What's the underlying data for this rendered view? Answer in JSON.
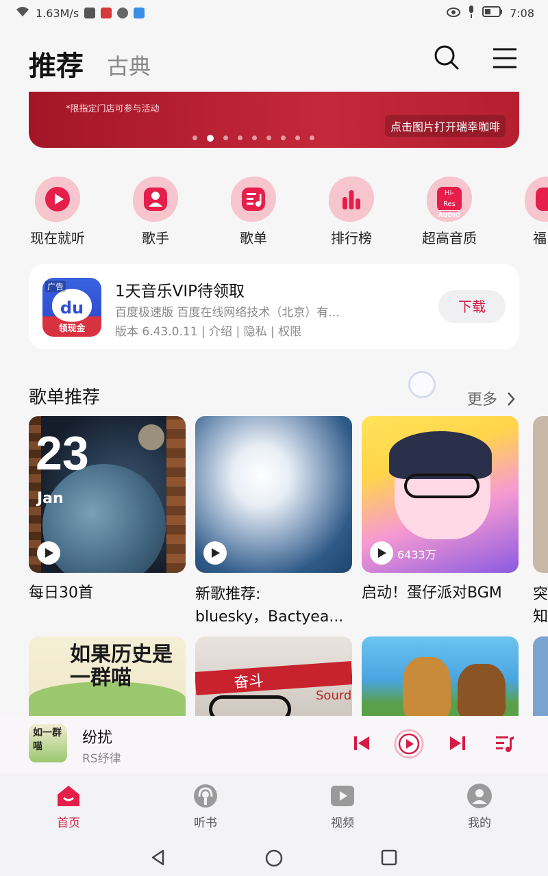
{
  "status_bar": {
    "speed": "1.63M/s",
    "time": "7:08"
  },
  "header": {
    "tab_active": "推荐",
    "tab_inactive": "古典",
    "search_icon": "search-icon",
    "menu_icon": "menu-icon"
  },
  "banner": {
    "note": "*限指定门店可参与活动",
    "cta": "点击图片打开瑞幸咖啡",
    "dot_count": 9,
    "active_dot": 2
  },
  "quick_nav": [
    {
      "label": "现在就听",
      "icon": "play-circle-icon"
    },
    {
      "label": "歌手",
      "icon": "singer-icon"
    },
    {
      "label": "歌单",
      "icon": "playlist-icon"
    },
    {
      "label": "排行榜",
      "icon": "chart-bars-icon"
    },
    {
      "label": "超高音质",
      "icon": "hi-res-icon",
      "badge_top": "Hi-Res",
      "badge_bottom": "AUDIO"
    },
    {
      "label": "福",
      "icon": "benefit-icon"
    }
  ],
  "ad": {
    "badge": "广告",
    "logo_text": "du",
    "logo_strip": "领现金",
    "title": "1天音乐VIP待领取",
    "subtitle": "百度极速版  百度在线网络技术（北京）有...",
    "meta": "版本 6.43.0.11 | 介绍 | 隐私 | 权限",
    "button": "下载"
  },
  "section": {
    "title": "歌单推荐",
    "more": "更多"
  },
  "playlists": [
    {
      "title": "每日30首",
      "date_day": "23",
      "date_month": "Jan"
    },
    {
      "title_line1": "新歌推荐:",
      "title_line2": "bluesky，Bactyea..."
    },
    {
      "title": "启动！蛋仔派对BGM",
      "play_count": "6433万"
    },
    {
      "title_line1": "突",
      "title_line2": "知"
    }
  ],
  "row2": {
    "card1_text": "如果历史是一群喵",
    "card2_text": "奋斗",
    "card2_extra": "Sourd"
  },
  "player": {
    "song": "纷扰",
    "artist": "RS纾律",
    "thumb_text": "如一群喵"
  },
  "bottom_nav": [
    {
      "label": "首页",
      "active": true
    },
    {
      "label": "听书",
      "active": false
    },
    {
      "label": "视频",
      "active": false
    },
    {
      "label": "我的",
      "active": false
    }
  ],
  "colors": {
    "accent": "#d41c46",
    "icon_bg": "#f7c5ce"
  }
}
